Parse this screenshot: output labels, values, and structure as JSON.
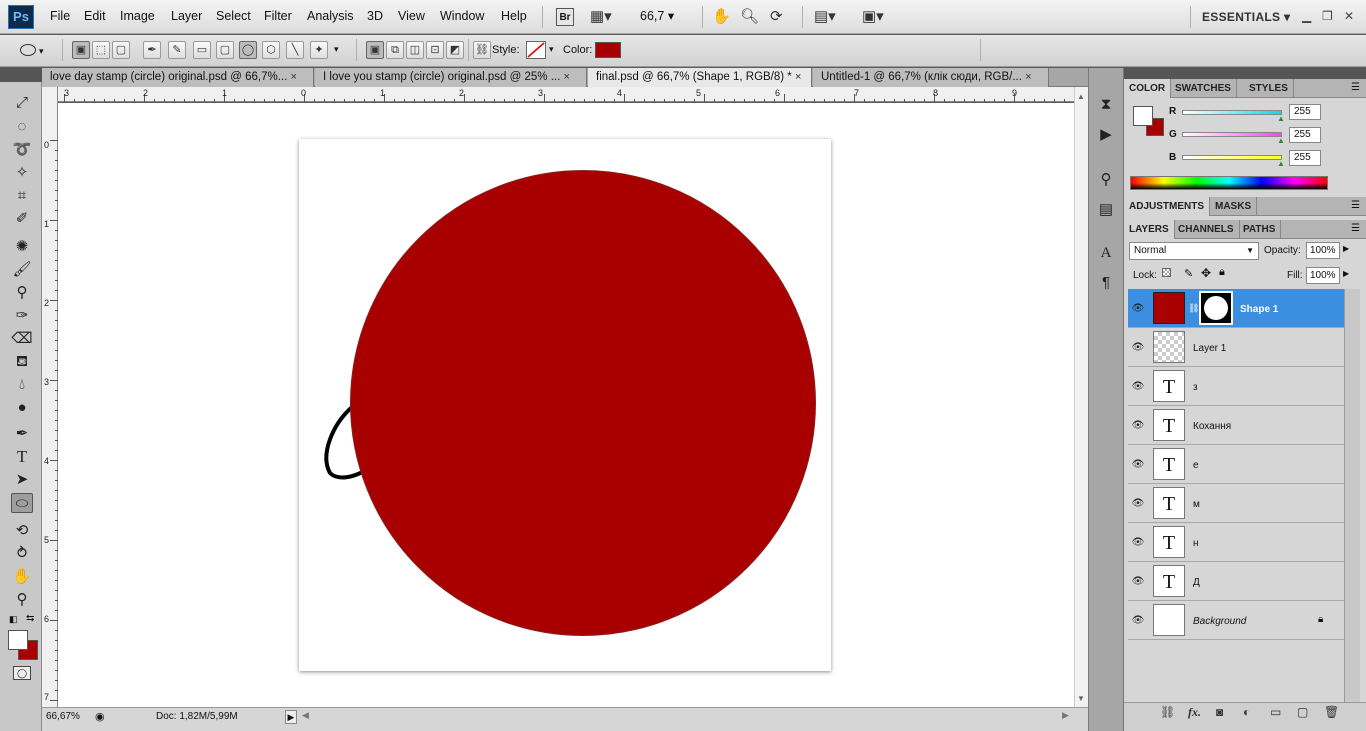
{
  "app": {
    "logo": "Ps",
    "menu": [
      "File",
      "Edit",
      "Image",
      "Layer",
      "Select",
      "Filter",
      "Analysis",
      "3D",
      "View",
      "Window",
      "Help"
    ],
    "bridge": "Br",
    "zoom": "66,7",
    "workspace": "ESSENTIALS"
  },
  "options": {
    "style_label": "Style:",
    "color_label": "Color:",
    "color": "#a80000"
  },
  "tabs": [
    {
      "label": "love day stamp (circle) original.psd @ 66,7%...",
      "close": "×"
    },
    {
      "label": "I love you stamp (circle) original.psd @ 25% ...",
      "close": "×"
    },
    {
      "label": "final.psd @ 66,7% (Shape 1, RGB/8) *",
      "close": "×"
    },
    {
      "label": "Untitled-1 @ 66,7% (клік сюди, RGB/...",
      "close": "×"
    }
  ],
  "rulers": {
    "top": [
      "3",
      "2",
      "1",
      "0",
      "1",
      "2",
      "3",
      "4",
      "5",
      "6",
      "7",
      "8",
      "9"
    ],
    "left": [
      "0",
      "1",
      "2",
      "3",
      "4",
      "5",
      "6",
      "7"
    ]
  },
  "status": {
    "zoom": "66,67%",
    "doc": "Doc: 1,82M/5,99M"
  },
  "color_panel": {
    "tabs": [
      "COLOR",
      "SWATCHES",
      "STYLES"
    ],
    "channels": [
      {
        "label": "R",
        "value": "255",
        "color": "#00e0e0"
      },
      {
        "label": "G",
        "value": "255",
        "color": "#ff40ff"
      },
      {
        "label": "B",
        "value": "255",
        "color": "#ffff20"
      }
    ],
    "foreground": "#ffffff",
    "background": "#a80000"
  },
  "adjust_panel": {
    "tabs": [
      "ADJUSTMENTS",
      "MASKS"
    ]
  },
  "layers_panel": {
    "tabs": [
      "LAYERS",
      "CHANNELS",
      "PATHS"
    ],
    "blend_mode": "Normal",
    "opacity_label": "Opacity:",
    "opacity": "100%",
    "lock_label": "Lock:",
    "fill_label": "Fill:",
    "fill": "100%",
    "layers": [
      {
        "name": "Shape 1",
        "type": "shape",
        "selected": true
      },
      {
        "name": "Layer 1",
        "type": "pixel",
        "selected": false
      },
      {
        "name": "з",
        "type": "text",
        "selected": false
      },
      {
        "name": "Кохання",
        "type": "text",
        "selected": false
      },
      {
        "name": "е",
        "type": "text",
        "selected": false
      },
      {
        "name": "м",
        "type": "text",
        "selected": false
      },
      {
        "name": "н",
        "type": "text",
        "selected": false
      },
      {
        "name": "Д",
        "type": "text",
        "selected": false
      },
      {
        "name": "Background",
        "type": "background",
        "selected": false
      }
    ],
    "text_thumb": "T"
  }
}
